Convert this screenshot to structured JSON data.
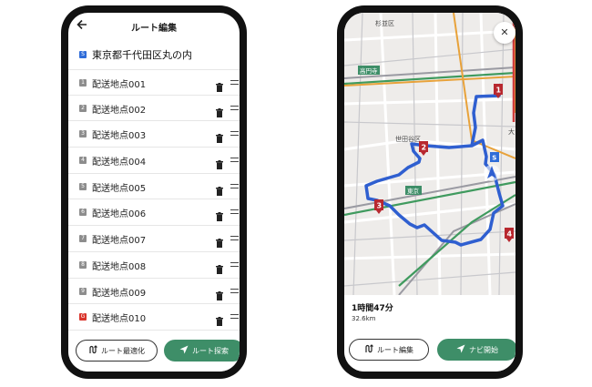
{
  "left": {
    "title": "ルート編集",
    "back_icon": "arrow-left-icon",
    "start": {
      "badge": "S",
      "label": "東京都千代田区丸の内"
    },
    "stops": [
      {
        "num": "1",
        "label": "配送地点001"
      },
      {
        "num": "2",
        "label": "配送地点002"
      },
      {
        "num": "3",
        "label": "配送地点003"
      },
      {
        "num": "4",
        "label": "配送地点004"
      },
      {
        "num": "5",
        "label": "配送地点005"
      },
      {
        "num": "6",
        "label": "配送地点006"
      },
      {
        "num": "7",
        "label": "配送地点007"
      },
      {
        "num": "8",
        "label": "配送地点008"
      },
      {
        "num": "9",
        "label": "配送地点009"
      },
      {
        "num": "G",
        "label": "配送地点010"
      }
    ],
    "buttons": {
      "optimize": "ルート最適化",
      "search": "ルート探索"
    }
  },
  "right": {
    "map_labels": {
      "suginami": "杉並区",
      "koenji": "高円寺",
      "setagaya": "世田谷区",
      "tokyo": "東京",
      "dai": "大"
    },
    "markers": [
      "1",
      "2",
      "3",
      "4",
      "S"
    ],
    "summary": {
      "duration": "1時間47分",
      "distance": "32.6km"
    },
    "buttons": {
      "route_edit": "ルート編集",
      "navi": "ナビ開始"
    }
  },
  "colors": {
    "accent_green": "#3e8e68",
    "route_blue": "#2f5fd0",
    "marker_red": "#b8282f",
    "start_blue": "#2f6cd8",
    "goal_red": "#d9342b"
  }
}
